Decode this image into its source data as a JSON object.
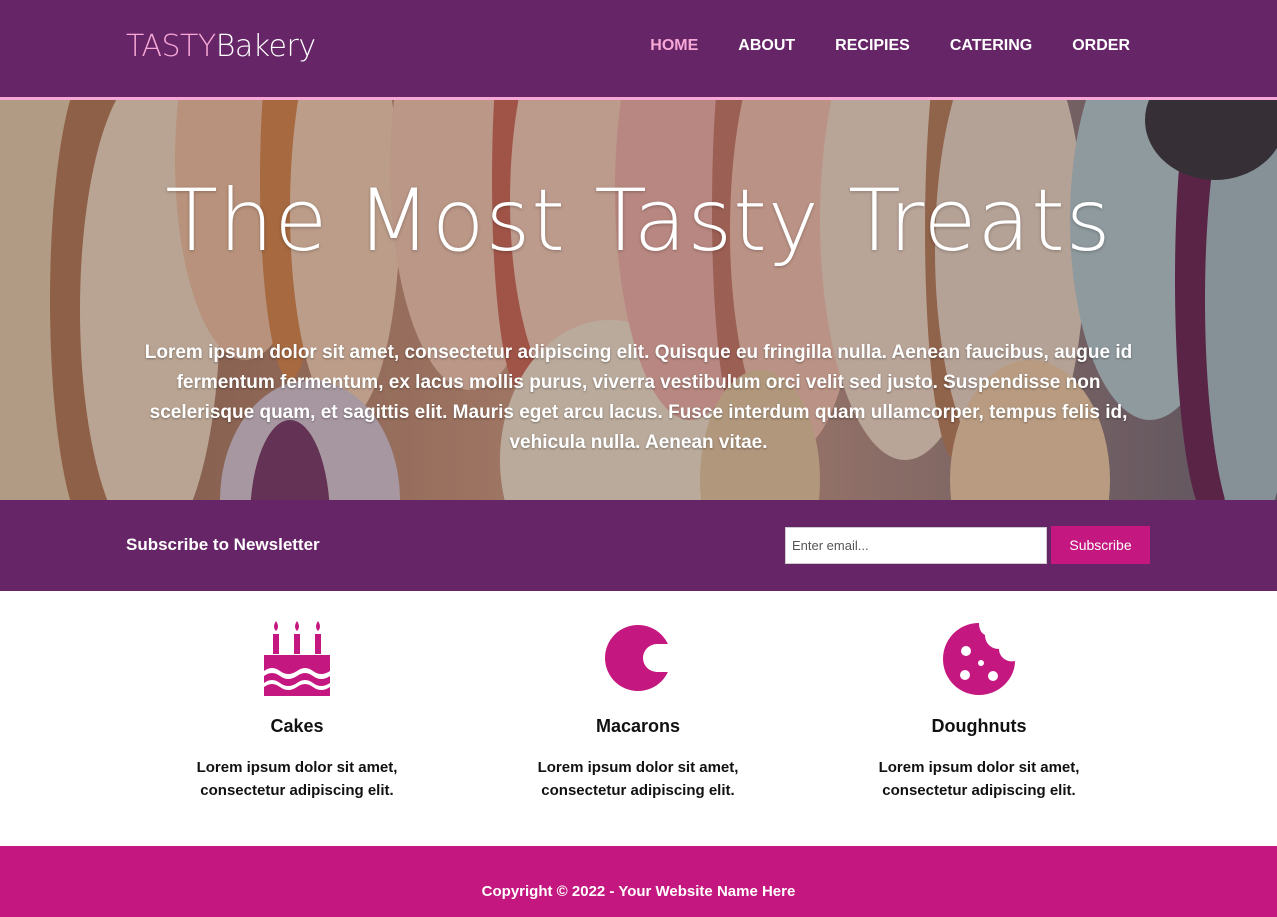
{
  "header": {
    "logo_part1": "TASTY",
    "logo_part2": "Bakery",
    "nav": [
      {
        "label": "HOME",
        "active": true
      },
      {
        "label": "ABOUT"
      },
      {
        "label": "RECIPIES"
      },
      {
        "label": "CATERING"
      },
      {
        "label": "ORDER"
      }
    ]
  },
  "hero": {
    "title": "The Most Tasty Treats",
    "text": "Lorem ipsum dolor sit amet, consectetur adipiscing elit. Quisque eu fringilla nulla. Aenean faucibus, augue id fermentum fermentum, ex lacus mollis purus, viverra vestibulum orci velit sed justo. Suspendisse non scelerisque quam, et sagittis elit. Mauris eget arcu lacus. Fusce interdum quam ullamcorper, tempus felis id, vehicula nulla. Aenean vitae."
  },
  "newsletter": {
    "title": "Subscribe to Newsletter",
    "placeholder": "Enter email...",
    "button_label": "Subscribe"
  },
  "features": [
    {
      "icon": "birthday-cake-icon",
      "title": "Cakes",
      "text": "Lorem ipsum dolor sit amet, consectetur adipiscing elit."
    },
    {
      "icon": "macaron-icon",
      "title": "Macarons",
      "text": "Lorem ipsum dolor sit amet, consectetur adipiscing elit."
    },
    {
      "icon": "cookie-bite-icon",
      "title": "Doughnuts",
      "text": "Lorem ipsum dolor sit amet, consectetur adipiscing elit."
    }
  ],
  "footer": {
    "text": "Copyright © 2022 - Your Website Name Here"
  },
  "colors": {
    "brand_purple": "#662567",
    "accent_pink": "#f7a8d6",
    "accent_magenta": "#c4177f"
  }
}
